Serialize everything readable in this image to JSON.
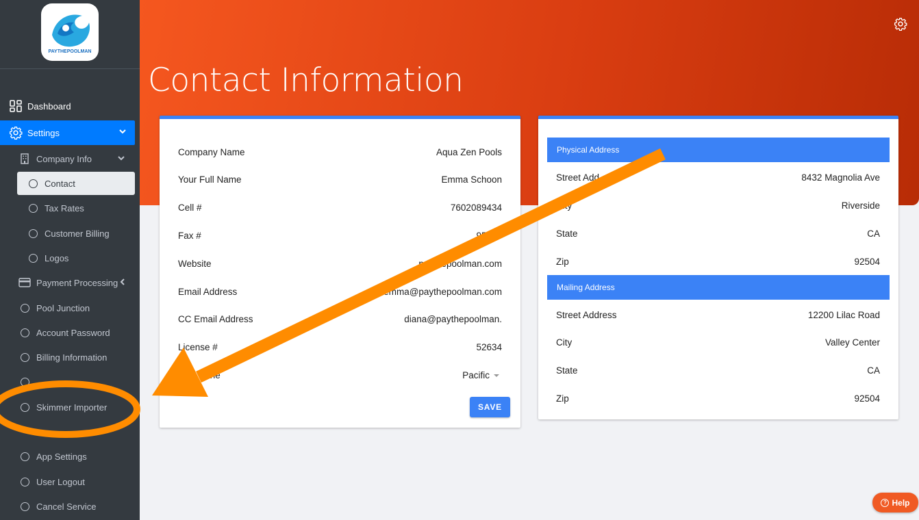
{
  "brand": {
    "logo_text": "PAYTHEPOOLMAN"
  },
  "sidebar": {
    "dashboard": "Dashboard",
    "settings": "Settings",
    "company_info": "Company Info",
    "contact": "Contact",
    "tax_rates": "Tax Rates",
    "customer_billing": "Customer Billing",
    "logos": "Logos",
    "payment_processing": "Payment Processing",
    "pool_junction": "Pool Junction",
    "account_password": "Account Password",
    "billing_information": "Billing Information",
    "skimmer_importer": "Skimmer Importer",
    "app_settings": "App Settings",
    "user_logout": "User Logout",
    "cancel_service": "Cancel Service"
  },
  "page": {
    "title": "Contact Information"
  },
  "contact": {
    "rows": [
      {
        "label": "Company Name",
        "value": "Aqua Zen Pools"
      },
      {
        "label": "Your Full Name",
        "value": "Emma Schoon"
      },
      {
        "label": "Cell #",
        "value": "7602089434"
      },
      {
        "label": "Fax #",
        "value": "95167"
      },
      {
        "label": "Website",
        "value": "paythepoolman.com"
      },
      {
        "label": "Email Address",
        "value": "emma@paythepoolman.com"
      },
      {
        "label": "CC Email Address",
        "value": "diana@paythepoolman."
      },
      {
        "label": "License #",
        "value": "52634"
      },
      {
        "label": "Zone",
        "value": "Pacific"
      }
    ],
    "save": "SAVE"
  },
  "address": {
    "physical_title": "Physical Address",
    "physical": [
      {
        "label": "Street Add",
        "value": "8432 Magnolia Ave"
      },
      {
        "label": "City",
        "value": "Riverside"
      },
      {
        "label": "State",
        "value": "CA"
      },
      {
        "label": "Zip",
        "value": "92504"
      }
    ],
    "mailing_title": "Mailing Address",
    "mailing": [
      {
        "label": "Street Address",
        "value": "12200 Lilac Road"
      },
      {
        "label": "City",
        "value": "Valley Center"
      },
      {
        "label": "State",
        "value": "CA"
      },
      {
        "label": "Zip",
        "value": "92504"
      }
    ]
  },
  "help": {
    "label": "Help"
  },
  "colors": {
    "accent": "#3b82f6",
    "sidebar": "#343a40",
    "annotation": "#ff8c00",
    "header": "#e04515"
  }
}
